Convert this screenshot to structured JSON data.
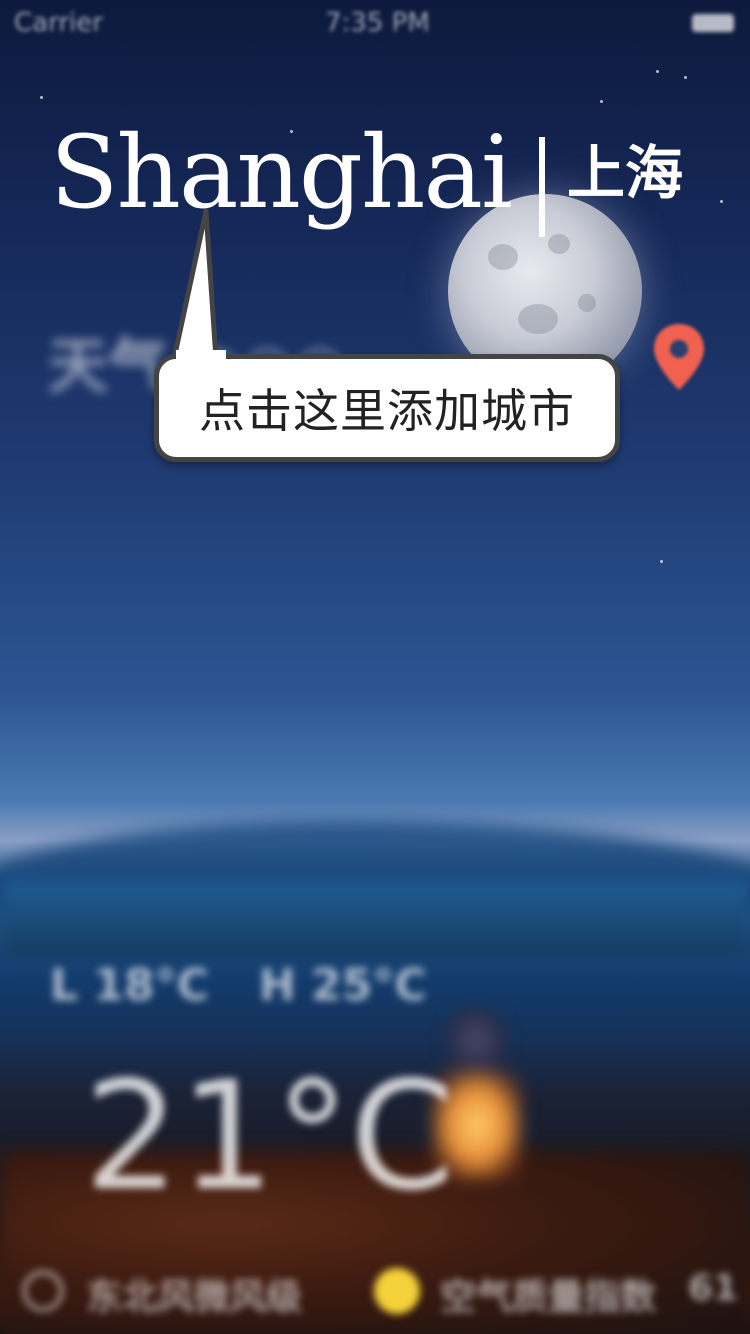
{
  "status_bar": {
    "carrier": "Carrier",
    "time": "7:35 PM"
  },
  "header": {
    "city_en": "Shanghai",
    "city_zh": "上海"
  },
  "weather": {
    "condition_label": "天气 ○○○",
    "low": "L 18°C",
    "high": "H 25°C",
    "current_temp": "21°C"
  },
  "tooltip": {
    "text": "点击这里添加城市"
  },
  "footer": {
    "wind": "东北风微风级",
    "air_quality": "空气质量指数",
    "air_value": "61"
  },
  "icons": {
    "location": "location-pin-icon",
    "moon": "moon-icon",
    "wind": "wind-icon",
    "air": "air-quality-icon"
  },
  "colors": {
    "pin": "#f0614f",
    "tooltip_border": "#444444",
    "air_icon": "#f5d23a"
  }
}
